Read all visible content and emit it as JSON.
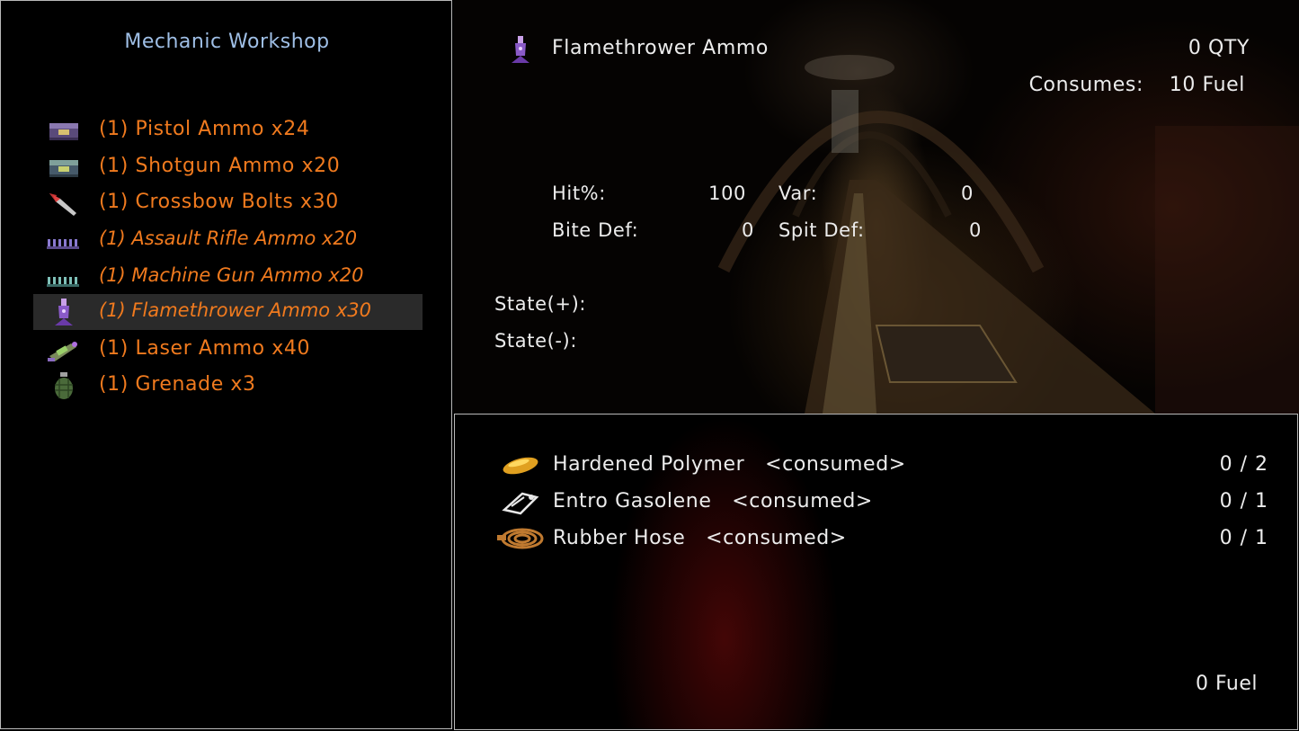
{
  "workshop": {
    "title": "Mechanic Workshop",
    "recipes": [
      {
        "label": "(1) Pistol Ammo x24",
        "icon": "ammo-box-icon"
      },
      {
        "label": "(1) Shotgun Ammo x20",
        "icon": "ammo-box-icon"
      },
      {
        "label": "(1) Crossbow Bolts x30",
        "icon": "crossbow-bolt-icon"
      },
      {
        "label": "(1) Assault Rifle Ammo x20",
        "icon": "rifle-rounds-icon"
      },
      {
        "label": "(1) Machine Gun Ammo x20",
        "icon": "machine-gun-rounds-icon"
      },
      {
        "label": "(1) Flamethrower Ammo x30",
        "icon": "flame-canister-icon"
      },
      {
        "label": "(1) Laser Ammo x40",
        "icon": "laser-cell-icon"
      },
      {
        "label": "(1) Grenade x3",
        "icon": "grenade-icon"
      }
    ],
    "selected_index": 5
  },
  "detail": {
    "item_name": "Flamethrower Ammo",
    "icon": "flame-canister-icon",
    "qty": "0 QTY",
    "consumes_label": "Consumes:",
    "consumes_value": "10 Fuel",
    "stats": {
      "hit_label": "Hit%:",
      "hit_value": "100",
      "var_label": "Var:",
      "var_value": "0",
      "bite_label": "Bite Def:",
      "bite_value": "0",
      "spit_label": "Spit Def:",
      "spit_value": "0"
    },
    "state_plus": "State(+):",
    "state_minus": "State(-):"
  },
  "materials": {
    "items": [
      {
        "name": "Hardened Polymer",
        "tag": "<consumed>",
        "count": "0 / 2",
        "icon": "polymer-icon"
      },
      {
        "name": "Entro Gasolene",
        "tag": "<consumed>",
        "count": "0 / 1",
        "icon": "gasoline-icon"
      },
      {
        "name": "Rubber Hose",
        "tag": "<consumed>",
        "count": "0 / 1",
        "icon": "rubber-hose-icon"
      }
    ],
    "fuel_total": "0 Fuel"
  },
  "colors": {
    "recipe_text": "#f07a1e",
    "title_text": "#9fbfe6",
    "body_text": "#ececec",
    "selected_row": "#2a2a2a",
    "panel_border": "#b9b9b9"
  }
}
